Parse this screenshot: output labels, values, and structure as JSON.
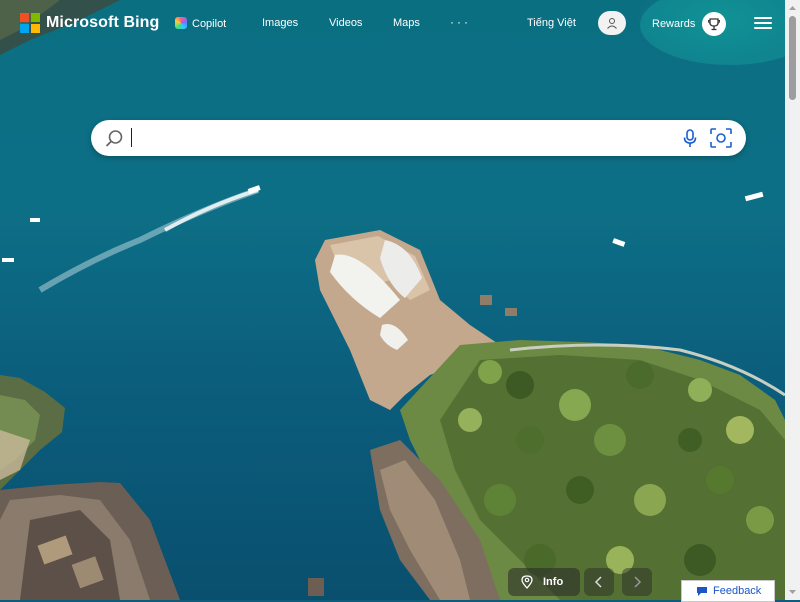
{
  "brand": {
    "name": "Microsoft Bing",
    "colors": [
      "#f25022",
      "#7fba00",
      "#00a4ef",
      "#ffb900"
    ]
  },
  "nav": {
    "copilot": "Copilot",
    "images": "Images",
    "videos": "Videos",
    "maps": "Maps",
    "more": "···"
  },
  "header": {
    "language": "Tiếng Việt",
    "rewards": "Rewards",
    "account_icon": "user-icon",
    "rewards_icon": "trophy-icon",
    "menu_icon": "hamburger-icon"
  },
  "search": {
    "value": "",
    "placeholder": "",
    "icons": [
      "search-icon",
      "microphone-icon",
      "visual-search-icon"
    ]
  },
  "footer": {
    "info": "Info",
    "feedback": "Feedback",
    "prev_icon": "chevron-left-icon",
    "next_icon": "chevron-right-icon"
  }
}
